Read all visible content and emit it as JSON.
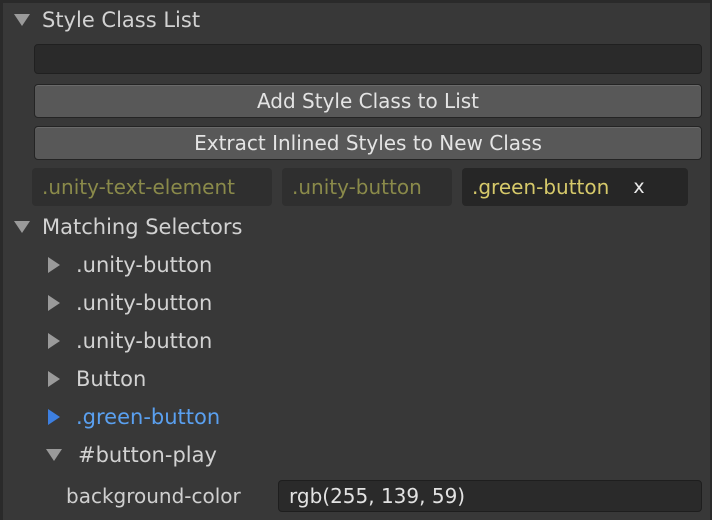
{
  "style_class_list": {
    "header": "Style Class List",
    "input_value": "",
    "add_button": "Add Style Class to List",
    "extract_button": "Extract Inlined Styles to New Class",
    "classes": [
      {
        "label": ".unity-text-element",
        "removable": false
      },
      {
        "label": ".unity-button",
        "removable": false
      },
      {
        "label": ".green-button",
        "removable": true,
        "remove_label": "x"
      }
    ]
  },
  "matching_selectors": {
    "header": "Matching Selectors",
    "items": [
      {
        "label": ".unity-button",
        "expanded": false
      },
      {
        "label": ".unity-button",
        "expanded": false
      },
      {
        "label": ".unity-button",
        "expanded": false
      },
      {
        "label": "Button",
        "expanded": false
      },
      {
        "label": ".green-button",
        "expanded": false,
        "highlighted": true
      },
      {
        "label": "#button-play",
        "expanded": true
      }
    ],
    "property": {
      "name": "background-color",
      "value": "rgb(255, 139, 59)"
    }
  },
  "colors": {
    "background": "#383838",
    "highlight_blue": "#5aa0f0",
    "class_text": "#d6c96a"
  }
}
